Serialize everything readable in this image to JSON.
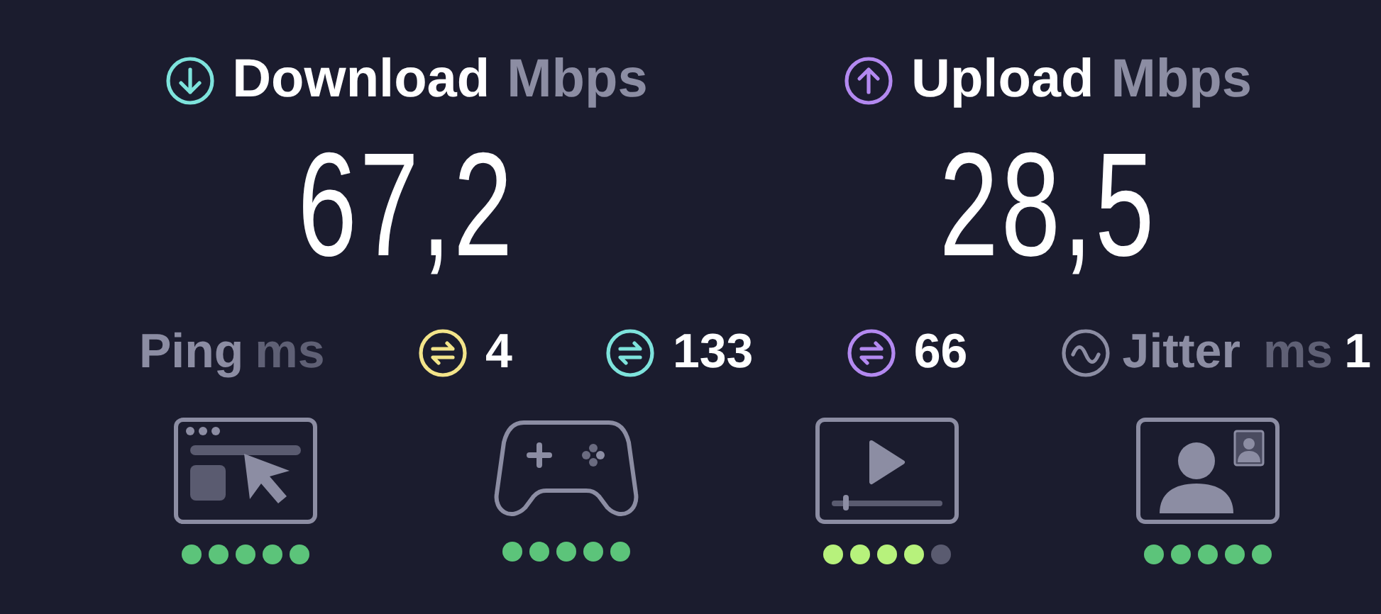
{
  "download": {
    "label": "Download",
    "unit": "Mbps",
    "value": "67,2"
  },
  "upload": {
    "label": "Upload",
    "unit": "Mbps",
    "value": "28,5"
  },
  "ping": {
    "label": "Ping",
    "unit": "ms"
  },
  "pings": [
    {
      "value": "4",
      "color": "#f3e48a"
    },
    {
      "value": "133",
      "color": "#7ee3dc"
    },
    {
      "value": "66",
      "color": "#b389f0"
    }
  ],
  "jitter": {
    "label": "Jitter",
    "unit": "ms",
    "value": "1"
  },
  "activities": [
    {
      "kind": "browsing",
      "stars": 5,
      "color": "#5cc47a"
    },
    {
      "kind": "gaming",
      "stars": 5,
      "color": "#5cc47a"
    },
    {
      "kind": "video",
      "stars": 4,
      "color": "#b7f27c"
    },
    {
      "kind": "call",
      "stars": 5,
      "color": "#5cc47a"
    }
  ]
}
